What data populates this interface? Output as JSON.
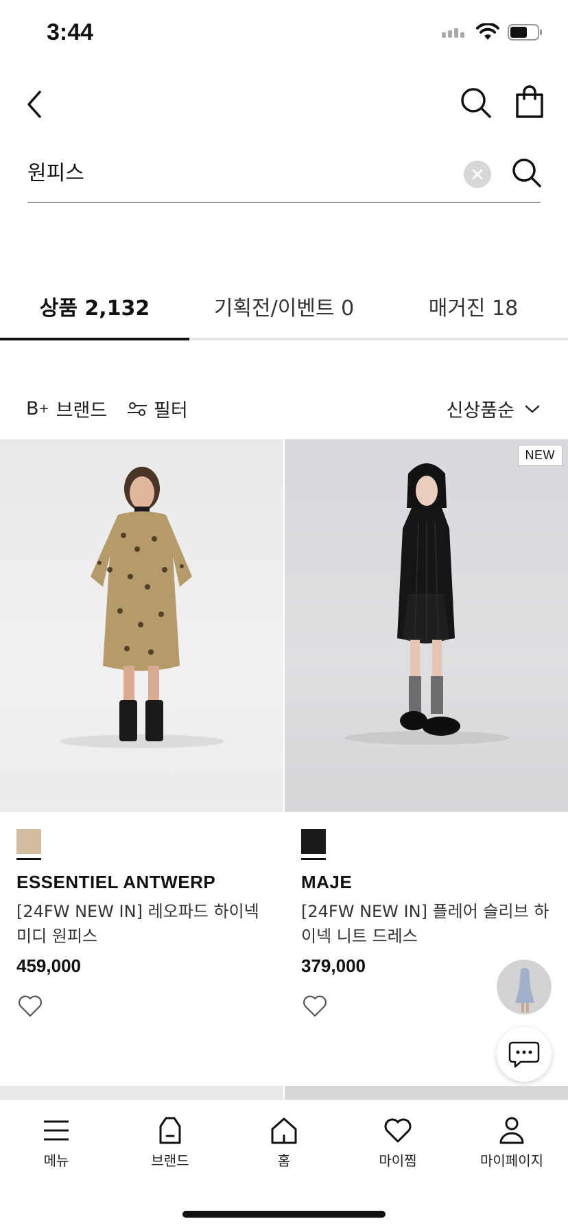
{
  "status_bar": {
    "time": "3:44"
  },
  "search": {
    "query": "원피스"
  },
  "tabs": [
    {
      "label": "상품 2,132",
      "active": true
    },
    {
      "label": "기획전/이벤트 0",
      "active": false
    },
    {
      "label": "매거진 18",
      "active": false
    }
  ],
  "filters": {
    "brand_label": "브랜드",
    "brand_prefix": "B",
    "brand_sup": "+",
    "filter_label": "필터",
    "sort_label": "신상품순"
  },
  "products": [
    {
      "badge": "",
      "swatch_color": "#d4bc9e",
      "brand": "ESSENTIEL ANTWERP",
      "title": "[24FW NEW IN] 레오파드 하이넥 미디 원피스",
      "price": "459,000"
    },
    {
      "badge": "NEW",
      "swatch_color": "#1b1b1b",
      "brand": "MAJE",
      "title": "[24FW NEW IN] 플레어 슬리브 하이넥 니트 드레스",
      "price": "379,000"
    }
  ],
  "bottom_nav": [
    {
      "label": "메뉴",
      "icon": "menu-icon"
    },
    {
      "label": "브랜드",
      "icon": "brand-bag-icon"
    },
    {
      "label": "홈",
      "icon": "home-icon"
    },
    {
      "label": "마이찜",
      "icon": "heart-icon"
    },
    {
      "label": "마이페이지",
      "icon": "person-icon"
    }
  ]
}
